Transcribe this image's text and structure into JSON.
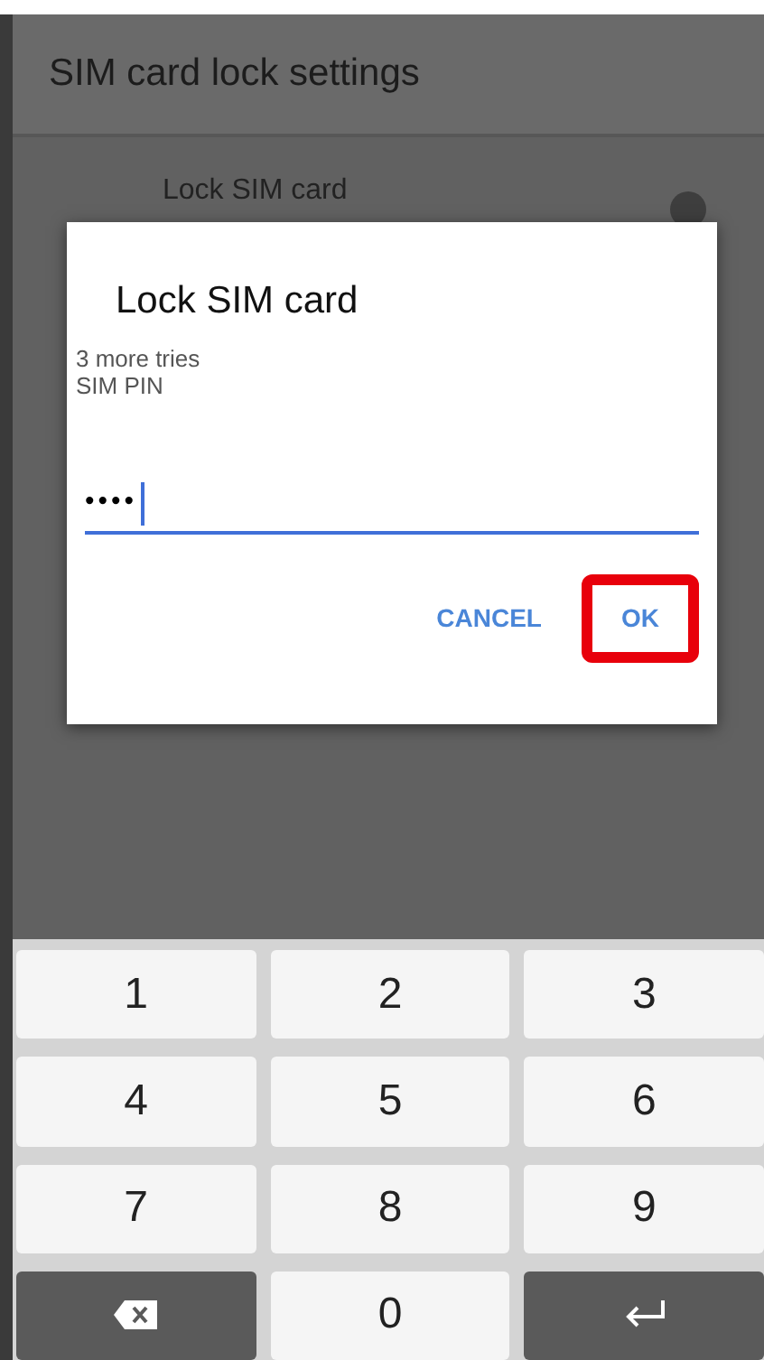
{
  "app_bar": {
    "title": "SIM card lock settings"
  },
  "setting": {
    "label": "Lock SIM card"
  },
  "dialog": {
    "title": "Lock SIM card",
    "tries": "3 more tries",
    "field_label": "SIM PIN",
    "value": "••••",
    "buttons": [
      {
        "label": "CANCEL",
        "highlighted": false
      },
      {
        "label": "OK",
        "highlighted": true
      }
    ]
  },
  "keypad": [
    {
      "kind": "digit",
      "label": "1"
    },
    {
      "kind": "digit",
      "label": "2"
    },
    {
      "kind": "digit",
      "label": "3"
    },
    {
      "kind": "digit",
      "label": "4"
    },
    {
      "kind": "digit",
      "label": "5"
    },
    {
      "kind": "digit",
      "label": "6"
    },
    {
      "kind": "digit",
      "label": "7"
    },
    {
      "kind": "digit",
      "label": "8"
    },
    {
      "kind": "digit",
      "label": "9"
    },
    {
      "kind": "backspace"
    },
    {
      "kind": "digit",
      "label": "0"
    },
    {
      "kind": "enter"
    }
  ]
}
